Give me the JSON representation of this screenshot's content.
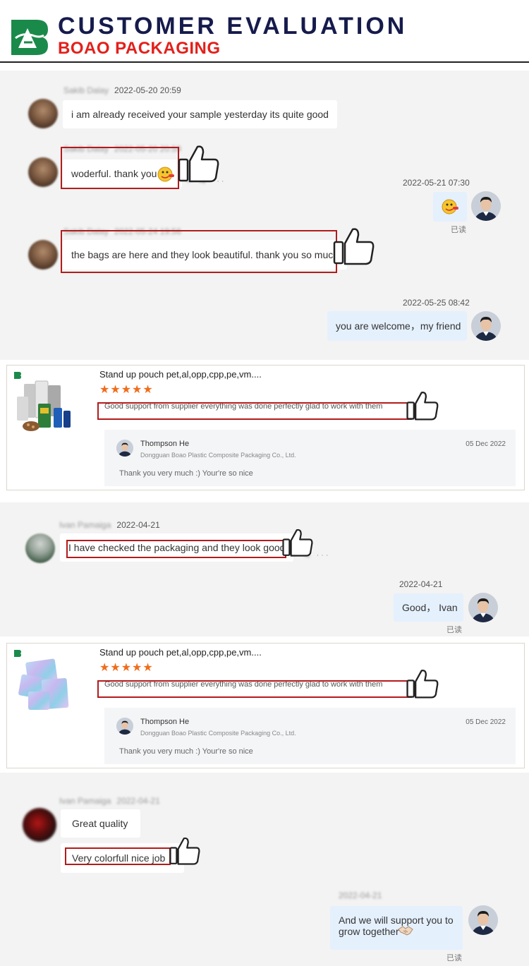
{
  "header": {
    "title": "CUSTOMER EVALUATION",
    "subtitle": "BOAO PACKAGING",
    "brand_green": "#1a8a4a",
    "brand_red": "#e3201b",
    "title_navy": "#161b4c"
  },
  "chat1": {
    "messages": [
      {
        "time": "2022-05-20 20:59",
        "text": "i am already received your sample yesterday its quite good"
      },
      {
        "time": "2022-05-20 20:59",
        "text": "woderful. thank you"
      },
      {
        "time": "2022-05-21 07:30",
        "read": "已读"
      },
      {
        "time": "2022-05-24 19:56",
        "text": "the bags are here and they look beautiful. thank you so much"
      },
      {
        "time": "2022-05-25 08:42",
        "text": "you are welcome，my friend"
      }
    ]
  },
  "review_cards": [
    {
      "product_title": "Stand up pouch pet,al,opp,cpp,pe,vm....",
      "stars": "★★★★★",
      "review": "Good support from supplier everything was done perfectly glad to work with them",
      "reply_name": "Thompson He",
      "reply_company": "Dongguan Boao Plastic Composite Packaging Co., Ltd.",
      "reply_date": "05 Dec 2022",
      "reply_text": "Thank you very much :) Your're so nice"
    },
    {
      "product_title": "Stand up pouch pet,al,opp,cpp,pe,vm....",
      "stars": "★★★★★",
      "review": "Good support from supplier everything was done perfectly glad to work with them",
      "reply_name": "Thompson He",
      "reply_company": "Dongguan Boao Plastic Composite Packaging Co., Ltd.",
      "reply_date": "05 Dec 2022",
      "reply_text": "Thank you very much :) Your're so nice"
    }
  ],
  "chat2": {
    "customer_name": "Ivan Pamaiga",
    "messages": [
      {
        "time": "2022-04-21",
        "text": "I have checked the packaging and they look good"
      },
      {
        "time": "2022-04-21",
        "text": "Good， Ivan",
        "read": "已读"
      }
    ]
  },
  "chat3": {
    "customer_name": "Ivan Pamaiga",
    "messages": [
      {
        "time": "2022-04-21",
        "text": "Great quality"
      },
      {
        "text": "Very colorfull nice job"
      },
      {
        "time": "2022-04-21",
        "text": "And we will support you to grow together",
        "read": "已读"
      }
    ]
  },
  "icons": {
    "thumbs_up": "thumbs-up-icon",
    "emoji": "emoji-icon",
    "handshake": "handshake-icon",
    "more": "more-icon"
  }
}
